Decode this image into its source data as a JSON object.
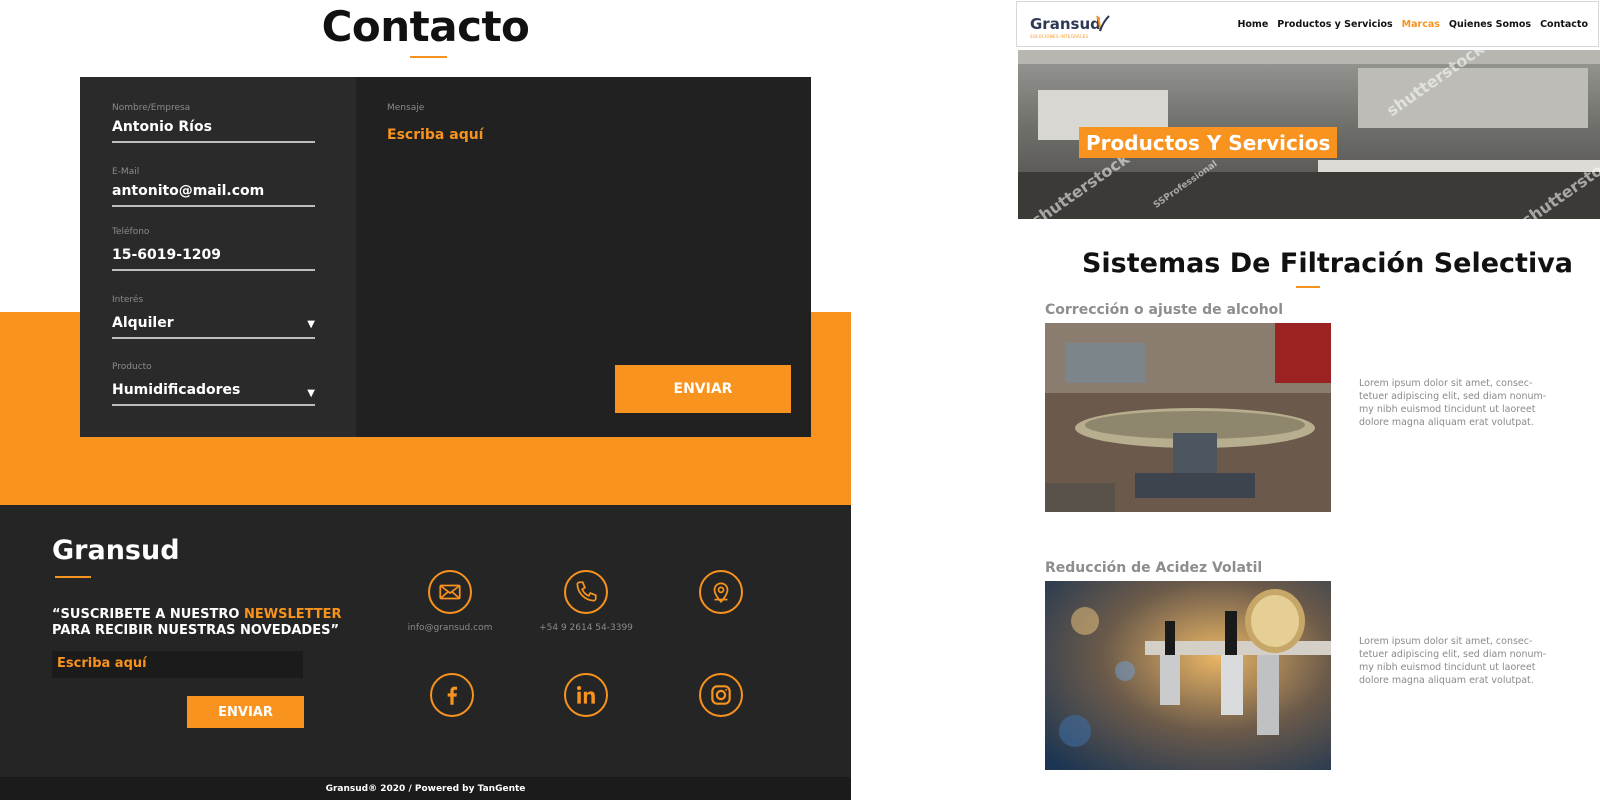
{
  "contact": {
    "title": "Contacto",
    "form": {
      "name_label": "Nombre/Empresa",
      "name_value": "Antonio Ríos",
      "email_label": "E-Mail",
      "email_value": "antonito@mail.com",
      "phone_label": "Teléfono",
      "phone_value": "15-6019-1209",
      "interest_label": "Interés",
      "interest_value": "Alquiler",
      "product_label": "Producto",
      "product_value": "Humidificadores",
      "message_label": "Mensaje",
      "message_placeholder": "Escriba aquí",
      "submit_label": "ENVIAR"
    }
  },
  "footer": {
    "brand": "Gransud",
    "newsletter_line1_prefix": "“SUSCRIBETE A NUESTRO ",
    "newsletter_accent": "NEWSLETTER",
    "newsletter_line2": "PARA RECIBIR NUESTRAS NOVEDADES”",
    "newsletter_placeholder": "Escriba aquí",
    "newsletter_button": "ENVIAR",
    "email": "info@gransud.com",
    "phone": "+54 9 2614 54-3399",
    "icons": [
      "mail-icon",
      "phone-icon",
      "location-icon",
      "facebook-icon",
      "linkedin-icon",
      "instagram-icon"
    ],
    "copyright": "Gransud® 2020 / Powered by TanGente"
  },
  "site": {
    "logo": "Gransud",
    "logo_tagline": "SOLUCIONES INTEGRALES",
    "nav": [
      "Home",
      "Productos y Servicios",
      "Marcas",
      "Quienes Somos",
      "Contacto"
    ],
    "nav_active": "Marcas",
    "hero_title": "Productos Y Servicios",
    "hero_watermarks": [
      "shutterstock",
      "shutterstock",
      "shutterstock",
      "SSProfessional"
    ],
    "section_title": "Sistemas De Filtración Selectiva",
    "products": [
      {
        "title": "Corrección o ajuste de alcohol",
        "desc_lines": [
          "Lorem ipsum dolor sit amet, consec-",
          "tetuer adipiscing elit, sed diam nonum-",
          "my nibh euismod tincidunt ut laoreet",
          "dolore magna aliquam erat volutpat."
        ]
      },
      {
        "title": "Reducción de Acidez Volatil",
        "desc_lines": [
          "Lorem ipsum dolor sit amet, consec-",
          "tetuer adipiscing elit, sed diam nonum-",
          "my nibh euismod tincidunt ut laoreet",
          "dolore magna aliquam erat volutpat."
        ]
      }
    ]
  },
  "colors": {
    "accent": "#f7931e",
    "dark": "#212121",
    "footer": "#252525"
  }
}
